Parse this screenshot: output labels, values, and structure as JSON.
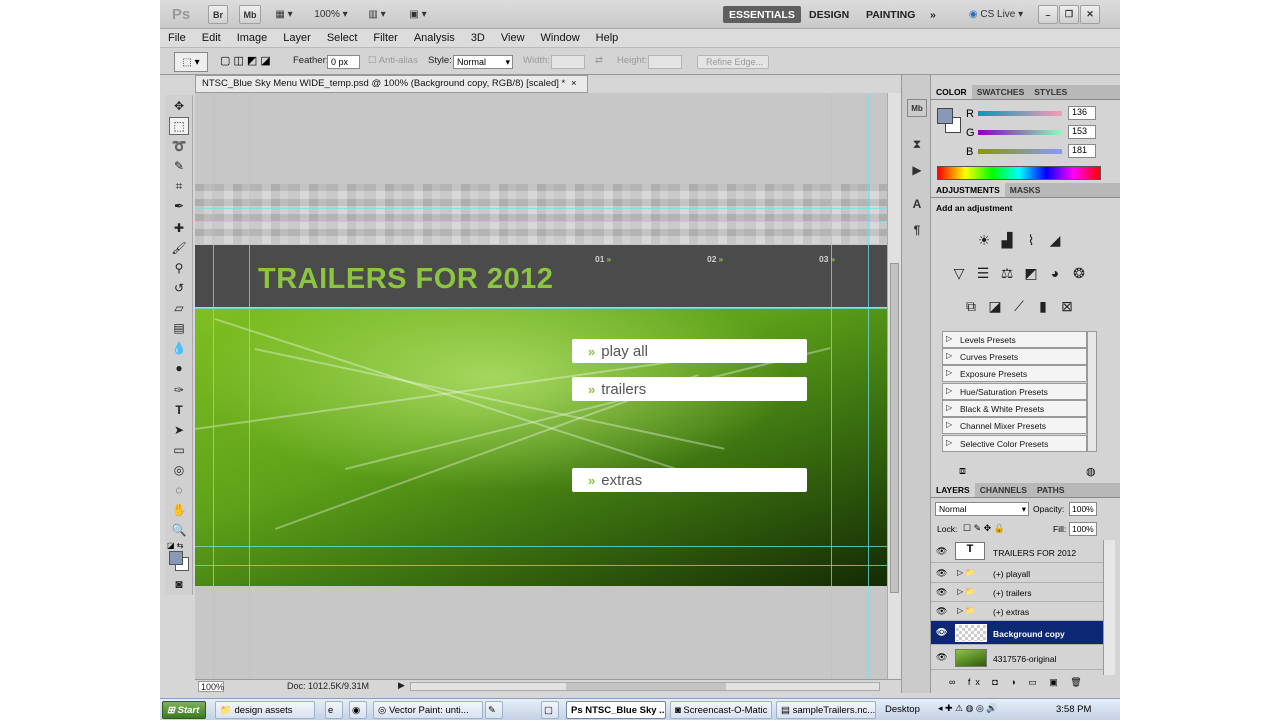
{
  "appbar": {
    "ps_logo": "Ps",
    "br_label": "Br",
    "mb_label": "Mb",
    "zoom": "100%",
    "workspaces": [
      "ESSENTIALS",
      "DESIGN",
      "PAINTING"
    ],
    "more_label": "»",
    "cslive": "CS Live"
  },
  "menu": [
    "File",
    "Edit",
    "Image",
    "Layer",
    "Select",
    "Filter",
    "Analysis",
    "3D",
    "View",
    "Window",
    "Help"
  ],
  "options": {
    "feather_label": "Feather:",
    "feather_value": "0 px",
    "antialias_label": "Anti-alias",
    "style_label": "Style:",
    "style_value": "Normal",
    "width_label": "Width:",
    "height_label": "Height:",
    "refine_edge": "Refine Edge..."
  },
  "document": {
    "tab_title": "NTSC_Blue Sky Menu WIDE_temp.psd @ 100% (Background copy, RGB/8) [scaled] *",
    "close": "×",
    "zoom": "100%",
    "doc_info": "Doc: 1012.5K/9.31M"
  },
  "canvas": {
    "banner_title": "TRAILERS FOR 2012",
    "nums": [
      "01",
      "02",
      "03"
    ],
    "chev": "»",
    "menu_buttons": [
      "play all",
      "trailers",
      "extras"
    ]
  },
  "color_panel": {
    "tabs": [
      "COLOR",
      "SWATCHES",
      "STYLES"
    ],
    "channels": [
      {
        "label": "R",
        "value": "136"
      },
      {
        "label": "G",
        "value": "153"
      },
      {
        "label": "B",
        "value": "181"
      }
    ],
    "fg_color": "#8899b5"
  },
  "adjustments": {
    "tabs": [
      "ADJUSTMENTS",
      "MASKS"
    ],
    "heading": "Add an adjustment",
    "presets": [
      "Levels Presets",
      "Curves Presets",
      "Exposure Presets",
      "Hue/Saturation Presets",
      "Black & White Presets",
      "Channel Mixer Presets",
      "Selective Color Presets"
    ]
  },
  "layers_panel": {
    "tabs": [
      "LAYERS",
      "CHANNELS",
      "PATHS"
    ],
    "blend_mode": "Normal",
    "opacity_label": "Opacity:",
    "opacity": "100%",
    "lock_label": "Lock:",
    "fill_label": "Fill:",
    "fill": "100%",
    "layers": [
      {
        "name": "TRAILERS FOR 2012",
        "type": "text"
      },
      {
        "name": "(+) playall",
        "type": "group"
      },
      {
        "name": "(+) trailers",
        "type": "group"
      },
      {
        "name": "(+) extras",
        "type": "group"
      },
      {
        "name": "Background copy",
        "type": "image",
        "selected": true
      },
      {
        "name": "4317576-original",
        "type": "image"
      }
    ]
  },
  "taskbar": {
    "start": "Start",
    "items": [
      "design assets",
      "Vector Paint: unti...",
      "NTSC_Blue Sky ...",
      "Screencast-O-Matic",
      "sampleTrailers.nc..."
    ],
    "desktop": "Desktop",
    "clock": "3:58 PM"
  },
  "colors": {
    "accent_green": "#8cc641",
    "banner_gray": "#4b4b4b",
    "selected_layer": "#0c2875"
  }
}
